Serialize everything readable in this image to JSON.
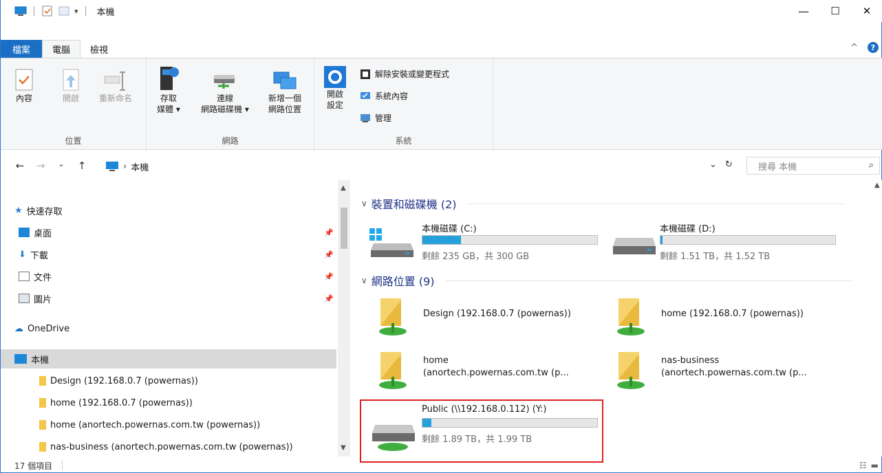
{
  "title": "本機",
  "window_buttons": {
    "minimize": "—",
    "maximize": "☐",
    "close": "✕"
  },
  "ribbon_tabs": {
    "file": "檔案",
    "computer": "電腦",
    "view": "檢視"
  },
  "ribbon": {
    "location": {
      "label": "位置",
      "properties": "內容",
      "open": "開啟",
      "rename": "重新命名"
    },
    "network": {
      "label": "網路",
      "access_media": [
        "存取",
        "媒體 ▾"
      ],
      "map_drive": [
        "連線",
        "網路磁碟機 ▾"
      ],
      "add_location": [
        "新增一個",
        "網路位置"
      ]
    },
    "system": {
      "label": "系統",
      "open_settings": [
        "開啟",
        "設定"
      ],
      "uninstall": "解除安裝或變更程式",
      "system_properties": "系統內容",
      "manage": "管理"
    }
  },
  "address": {
    "path": "本機",
    "search_placeholder": "搜尋 本機"
  },
  "nav": {
    "quick_access": "快速存取",
    "desktop": "桌面",
    "downloads": "下載",
    "documents": "文件",
    "pictures": "圖片",
    "onedrive": "OneDrive",
    "this_pc": "本機",
    "shares": [
      "Design (192.168.0.7 (powernas))",
      "home (192.168.0.7 (powernas))",
      "home (anortech.powernas.com.tw (powernas))",
      "nas-business (anortech.powernas.com.tw (powernas))"
    ]
  },
  "content": {
    "devices_header": "裝置和磁碟機 (2)",
    "drives": [
      {
        "name": "本機磁碟 (C:)",
        "free": "剩餘 235 GB，共 300 GB",
        "used_fraction": 0.22
      },
      {
        "name": "本機磁碟 (D:)",
        "free": "剩餘 1.51 TB，共 1.52 TB",
        "used_fraction": 0.01
      }
    ],
    "network_header": "網路位置 (9)",
    "network": [
      {
        "line1": "Design (192.168.0.7 (powernas))",
        "line2": ""
      },
      {
        "line1": "home (192.168.0.7 (powernas))",
        "line2": ""
      },
      {
        "line1": "home",
        "line2": "(anortech.powernas.com.tw (p..."
      },
      {
        "line1": "nas-business",
        "line2": "(anortech.powernas.com.tw (p..."
      }
    ],
    "public_drive": {
      "name": "Public (\\\\192.168.0.112) (Y:)",
      "free": "剩餘 1.89 TB，共 1.99 TB",
      "used_fraction": 0.05
    }
  },
  "status": {
    "count": "17 個項目"
  },
  "colors": {
    "accent": "#1a6fc4",
    "bar_fill": "#26a0da",
    "highlight": "#e02020",
    "header_text": "#1e3287"
  }
}
